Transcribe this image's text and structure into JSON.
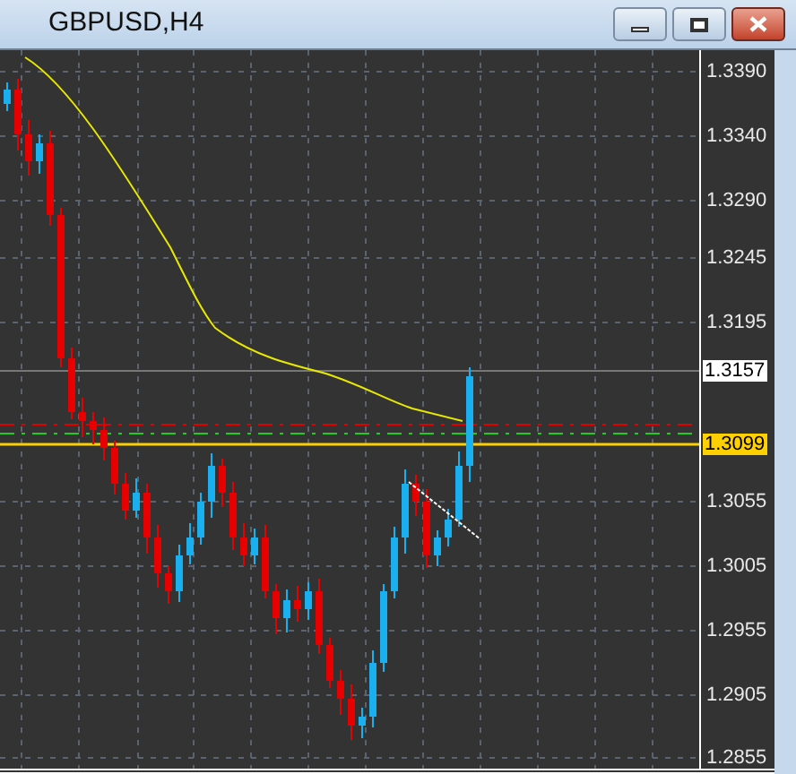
{
  "window": {
    "title": "GBPUSD,H4"
  },
  "price_axis": {
    "labels": [
      "1.3390",
      "1.3340",
      "1.3290",
      "1.3245",
      "1.3195",
      "1.3055",
      "1.3005",
      "1.2955",
      "1.2905",
      "1.2855"
    ]
  },
  "price_markers": [
    {
      "kind": "bid",
      "text": "1.3157"
    },
    {
      "kind": "level",
      "text": "1.3099"
    }
  ]
}
